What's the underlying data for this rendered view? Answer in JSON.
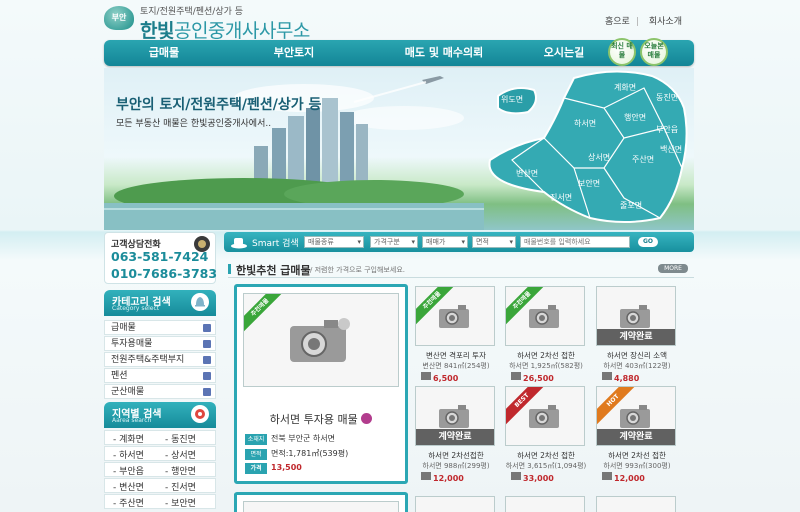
{
  "header": {
    "logo_mark": "부안",
    "tagline": "토지/전원주택/펜션/상가 등",
    "brand_bold": "한빛",
    "brand_rest": "공인중개사사무소",
    "links": [
      "홈으로",
      "회사소개"
    ]
  },
  "nav": {
    "items": [
      "급매물",
      "부안토지",
      "매도 및 매수의뢰",
      "오시는길"
    ],
    "side_buttons": [
      "최신 매물",
      "오늘본 매물"
    ]
  },
  "banner": {
    "title": "부안의 토지/전원주택/펜션/상가 등",
    "subtitle": "모든 부동산 매물은 한빛공인중개사에서..",
    "districts": [
      "위도면",
      "계화면",
      "동진면",
      "하서면",
      "행안면",
      "부안읍",
      "백산면",
      "변산면",
      "상서면",
      "주산면",
      "보안면",
      "진서면",
      "줄포면"
    ]
  },
  "sidebar": {
    "phone_label": "고객상담전화",
    "phones": [
      "063-581-7424",
      "010-7686-3783"
    ],
    "category": {
      "title": "카테고리 검색",
      "subtitle": "Category select",
      "items": [
        "급매물",
        "투자용매물",
        "전원주택&주택부지",
        "펜션",
        "군산매물"
      ]
    },
    "region": {
      "title": "지역별 검색",
      "subtitle": "Aarea search",
      "rows": [
        [
          "- 계화면",
          "- 동진면"
        ],
        [
          "- 하서면",
          "- 상서면"
        ],
        [
          "- 부안읍",
          "- 행안면"
        ],
        [
          "- 변산면",
          "- 진서면"
        ],
        [
          "- 주산면",
          "- 보안면"
        ]
      ]
    }
  },
  "search": {
    "title": "Smart 검색",
    "selects": [
      "매물종류",
      "가격구분",
      "매매가",
      "면적"
    ],
    "placeholder": "매물번호를 입력하세요",
    "go": "GO"
  },
  "recommend": {
    "title": "한빛추천 급매물",
    "subtitle": "/ 저렴한 가격으로 구입해보세요.",
    "more": "MORE",
    "featured": {
      "ribbon": "추천매물",
      "title": "하서면 투자용 매물",
      "rows": [
        {
          "label": "소재지",
          "value": "전북 부안군 하서면"
        },
        {
          "label": "면적",
          "value": "면적:1,781㎡(539평)"
        },
        {
          "label": "가격",
          "value": "13,500"
        }
      ]
    },
    "cards": [
      {
        "ribbon": "추천매물",
        "ribbon_color": "#3aa63a",
        "sold": "",
        "title": "변산면 격포리 투자",
        "area": "변산면 841㎡(254평)",
        "price": "6,500"
      },
      {
        "ribbon": "추천매물",
        "ribbon_color": "#3aa63a",
        "sold": "",
        "title": "하서면 2차선 접한",
        "area": "하서면 1,925㎡(582평)",
        "price": "26,500"
      },
      {
        "ribbon": "",
        "ribbon_color": "",
        "sold": "계약완료",
        "title": "하서면 장신리 소액",
        "area": "하서면 403㎡(122평)",
        "price": "4,880"
      },
      {
        "ribbon": "",
        "ribbon_color": "",
        "sold": "계약완료",
        "title": "하서면 2차선접한",
        "area": "하서면 988㎡(299평)",
        "price": "12,000"
      },
      {
        "ribbon": "BEST",
        "ribbon_color": "#c0282d",
        "sold": "",
        "title": "하서면 2차선 접한",
        "area": "하서면 3,615㎡(1,094평)",
        "price": "33,000"
      },
      {
        "ribbon": "HOT",
        "ribbon_color": "#e07a1e",
        "sold": "계약완료",
        "title": "하서면 2차선 접한",
        "area": "하서면 993㎡(300평)",
        "price": "12,000"
      }
    ]
  }
}
